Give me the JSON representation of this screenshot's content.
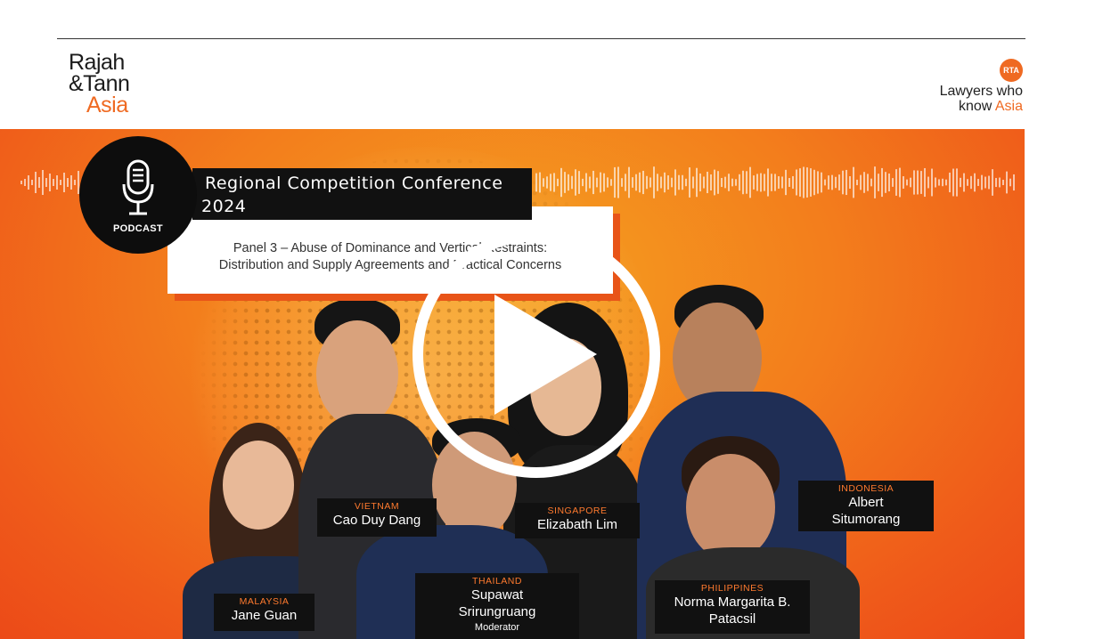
{
  "logo": {
    "line1": "Rajah",
    "line2": "&Tann",
    "line3": "Asia",
    "accent_color": "#ef6a22"
  },
  "tagline": {
    "badge": "RTA",
    "line1": "Lawyers who",
    "line2_pre": "know ",
    "line2_accent": "Asia"
  },
  "podcast": {
    "label": "PODCAST"
  },
  "title": {
    "line1": "Regional Competition Conference",
    "line2": "2024"
  },
  "subtitle": {
    "line1": "Panel 3 – Abuse of Dominance and Vertical Restraints:",
    "line2": "Distribution and Supply Agreements and Practical Concerns"
  },
  "speakers": [
    {
      "country": "VIETNAM",
      "name": "Cao Duy Dang"
    },
    {
      "country": "SINGAPORE",
      "name": "Elizabath Lim"
    },
    {
      "country": "INDONESIA",
      "name_line1": "Albert",
      "name_line2": "Situmorang"
    },
    {
      "country": "MALAYSIA",
      "name": "Jane Guan"
    },
    {
      "country": "THAILAND",
      "name_line1": "Supawat",
      "name_line2": "Srirungruang",
      "role": "Moderator"
    },
    {
      "country": "PHILIPPINES",
      "name_line1": "Norma Margarita B.",
      "name_line2": "Patacsil"
    }
  ],
  "colors": {
    "accent": "#ef6a22",
    "banner": "#f37d1c",
    "dark": "#111111"
  },
  "icons": {
    "play": "play-icon",
    "microphone": "microphone-icon"
  }
}
